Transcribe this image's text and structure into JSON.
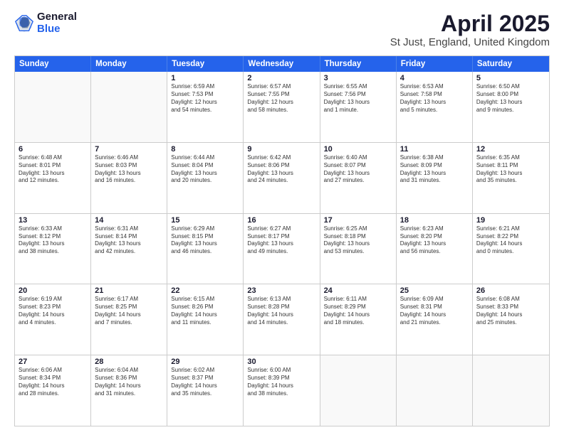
{
  "header": {
    "logo_general": "General",
    "logo_blue": "Blue",
    "month_title": "April 2025",
    "location": "St Just, England, United Kingdom"
  },
  "weekdays": [
    "Sunday",
    "Monday",
    "Tuesday",
    "Wednesday",
    "Thursday",
    "Friday",
    "Saturday"
  ],
  "weeks": [
    [
      {
        "day": "",
        "text": ""
      },
      {
        "day": "",
        "text": ""
      },
      {
        "day": "1",
        "text": "Sunrise: 6:59 AM\nSunset: 7:53 PM\nDaylight: 12 hours\nand 54 minutes."
      },
      {
        "day": "2",
        "text": "Sunrise: 6:57 AM\nSunset: 7:55 PM\nDaylight: 12 hours\nand 58 minutes."
      },
      {
        "day": "3",
        "text": "Sunrise: 6:55 AM\nSunset: 7:56 PM\nDaylight: 13 hours\nand 1 minute."
      },
      {
        "day": "4",
        "text": "Sunrise: 6:53 AM\nSunset: 7:58 PM\nDaylight: 13 hours\nand 5 minutes."
      },
      {
        "day": "5",
        "text": "Sunrise: 6:50 AM\nSunset: 8:00 PM\nDaylight: 13 hours\nand 9 minutes."
      }
    ],
    [
      {
        "day": "6",
        "text": "Sunrise: 6:48 AM\nSunset: 8:01 PM\nDaylight: 13 hours\nand 12 minutes."
      },
      {
        "day": "7",
        "text": "Sunrise: 6:46 AM\nSunset: 8:03 PM\nDaylight: 13 hours\nand 16 minutes."
      },
      {
        "day": "8",
        "text": "Sunrise: 6:44 AM\nSunset: 8:04 PM\nDaylight: 13 hours\nand 20 minutes."
      },
      {
        "day": "9",
        "text": "Sunrise: 6:42 AM\nSunset: 8:06 PM\nDaylight: 13 hours\nand 24 minutes."
      },
      {
        "day": "10",
        "text": "Sunrise: 6:40 AM\nSunset: 8:07 PM\nDaylight: 13 hours\nand 27 minutes."
      },
      {
        "day": "11",
        "text": "Sunrise: 6:38 AM\nSunset: 8:09 PM\nDaylight: 13 hours\nand 31 minutes."
      },
      {
        "day": "12",
        "text": "Sunrise: 6:35 AM\nSunset: 8:11 PM\nDaylight: 13 hours\nand 35 minutes."
      }
    ],
    [
      {
        "day": "13",
        "text": "Sunrise: 6:33 AM\nSunset: 8:12 PM\nDaylight: 13 hours\nand 38 minutes."
      },
      {
        "day": "14",
        "text": "Sunrise: 6:31 AM\nSunset: 8:14 PM\nDaylight: 13 hours\nand 42 minutes."
      },
      {
        "day": "15",
        "text": "Sunrise: 6:29 AM\nSunset: 8:15 PM\nDaylight: 13 hours\nand 46 minutes."
      },
      {
        "day": "16",
        "text": "Sunrise: 6:27 AM\nSunset: 8:17 PM\nDaylight: 13 hours\nand 49 minutes."
      },
      {
        "day": "17",
        "text": "Sunrise: 6:25 AM\nSunset: 8:18 PM\nDaylight: 13 hours\nand 53 minutes."
      },
      {
        "day": "18",
        "text": "Sunrise: 6:23 AM\nSunset: 8:20 PM\nDaylight: 13 hours\nand 56 minutes."
      },
      {
        "day": "19",
        "text": "Sunrise: 6:21 AM\nSunset: 8:22 PM\nDaylight: 14 hours\nand 0 minutes."
      }
    ],
    [
      {
        "day": "20",
        "text": "Sunrise: 6:19 AM\nSunset: 8:23 PM\nDaylight: 14 hours\nand 4 minutes."
      },
      {
        "day": "21",
        "text": "Sunrise: 6:17 AM\nSunset: 8:25 PM\nDaylight: 14 hours\nand 7 minutes."
      },
      {
        "day": "22",
        "text": "Sunrise: 6:15 AM\nSunset: 8:26 PM\nDaylight: 14 hours\nand 11 minutes."
      },
      {
        "day": "23",
        "text": "Sunrise: 6:13 AM\nSunset: 8:28 PM\nDaylight: 14 hours\nand 14 minutes."
      },
      {
        "day": "24",
        "text": "Sunrise: 6:11 AM\nSunset: 8:29 PM\nDaylight: 14 hours\nand 18 minutes."
      },
      {
        "day": "25",
        "text": "Sunrise: 6:09 AM\nSunset: 8:31 PM\nDaylight: 14 hours\nand 21 minutes."
      },
      {
        "day": "26",
        "text": "Sunrise: 6:08 AM\nSunset: 8:33 PM\nDaylight: 14 hours\nand 25 minutes."
      }
    ],
    [
      {
        "day": "27",
        "text": "Sunrise: 6:06 AM\nSunset: 8:34 PM\nDaylight: 14 hours\nand 28 minutes."
      },
      {
        "day": "28",
        "text": "Sunrise: 6:04 AM\nSunset: 8:36 PM\nDaylight: 14 hours\nand 31 minutes."
      },
      {
        "day": "29",
        "text": "Sunrise: 6:02 AM\nSunset: 8:37 PM\nDaylight: 14 hours\nand 35 minutes."
      },
      {
        "day": "30",
        "text": "Sunrise: 6:00 AM\nSunset: 8:39 PM\nDaylight: 14 hours\nand 38 minutes."
      },
      {
        "day": "",
        "text": ""
      },
      {
        "day": "",
        "text": ""
      },
      {
        "day": "",
        "text": ""
      }
    ]
  ]
}
